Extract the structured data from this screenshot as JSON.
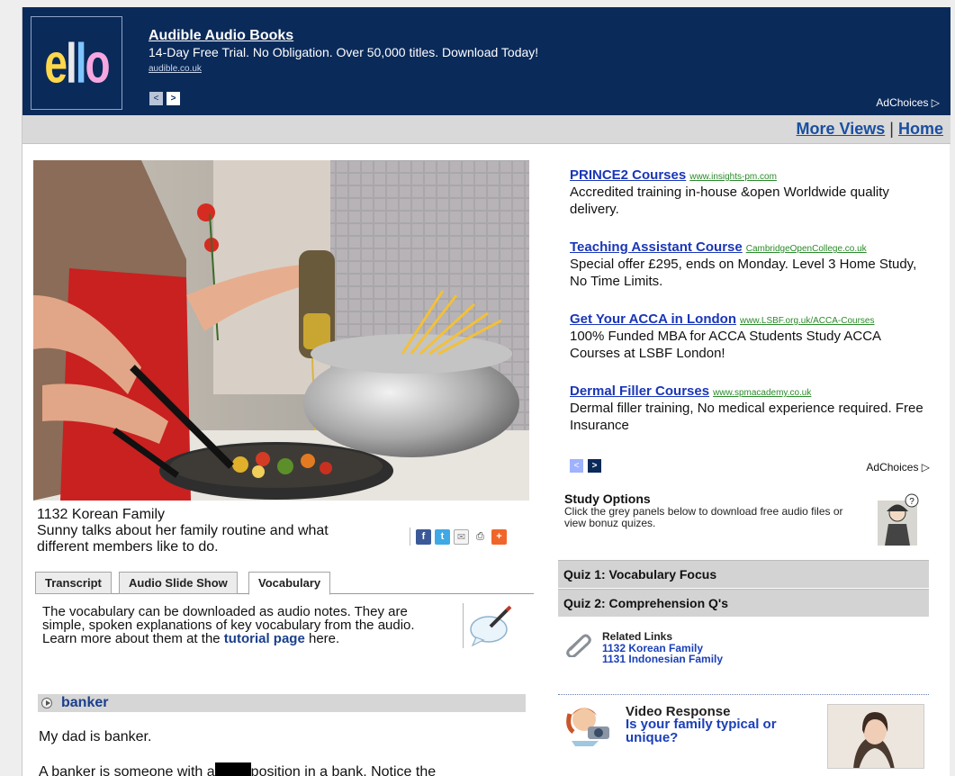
{
  "top_ad": {
    "logo": "ello",
    "title": "Audible Audio Books",
    "text": "14-Day Free Trial. No Obligation. Over 50,000 titles. Download Today!",
    "url": "audible.co.uk",
    "prev": "<",
    "next": ">",
    "adchoices": "AdChoices ▷"
  },
  "views_bar": {
    "more_views": "More Views",
    "separator": "|",
    "home": "Home"
  },
  "lesson": {
    "title": "1132 Korean Family",
    "description": "Sunny talks about her family routine and what different members like to do."
  },
  "share_icons": [
    "facebook-icon",
    "twitter-icon",
    "email-icon",
    "print-icon",
    "add-icon"
  ],
  "tabs": [
    {
      "label": "Transcript"
    },
    {
      "label": "Audio Slide Show"
    },
    {
      "label": "Vocabulary"
    }
  ],
  "vocab_intro": {
    "text_before": "The vocabulary can be downloaded as audio notes. They are simple, spoken explanations of key vocabulary from the audio. Learn more about them at the ",
    "link": "tutorial page",
    "text_after": " here."
  },
  "word_entry": {
    "word": "banker",
    "example": "My dad is banker.",
    "explain_before": "A banker is someone with a",
    "explain_after": "position in a bank. Notice the"
  },
  "right_ads": {
    "items": [
      {
        "title": "PRINCE2 Courses",
        "url": "www.insights-pm.com",
        "desc": "Accredited training in-house &open Worldwide quality delivery."
      },
      {
        "title": "Teaching Assistant Course",
        "url": "CambridgeOpenCollege.co.uk",
        "desc": "Special offer £295, ends on Monday. Level 3 Home Study, No Time Limits."
      },
      {
        "title": "Get Your ACCA in London",
        "url": "www.LSBF.org.uk/ACCA-Courses",
        "desc": "100% Funded MBA for ACCA Students Study ACCA Courses at LSBF London!"
      },
      {
        "title": "Dermal Filler Courses",
        "url": "www.spmacademy.co.uk",
        "desc": "Dermal filler training, No medical experience required. Free Insurance"
      }
    ],
    "prev": "<",
    "next": ">",
    "adchoices": "AdChoices ▷"
  },
  "study": {
    "title": "Study Options",
    "text": "Click the grey panels below to download free audio files or view bonuz quizes."
  },
  "quizzes": [
    {
      "label": "Quiz 1: Vocabulary Focus"
    },
    {
      "label": "Quiz 2: Comprehension Q's"
    }
  ],
  "related": {
    "title": "Related Links",
    "links": [
      "1132 Korean Family",
      "1131 Indonesian Family"
    ]
  },
  "video": {
    "title": "Video Response",
    "link": "Is your family typical or unique?"
  }
}
